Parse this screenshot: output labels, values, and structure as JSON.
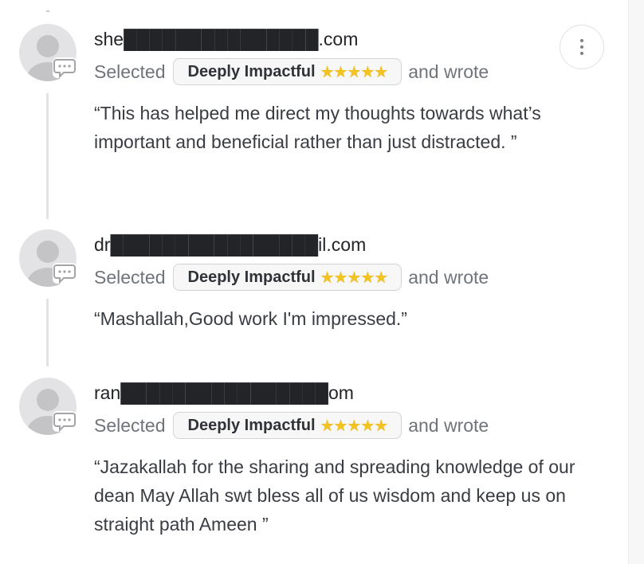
{
  "comments": [
    {
      "email": "she███████████████.com",
      "selected_text": "Selected",
      "reaction": "Deeply Impactful",
      "stars": "★★★★★",
      "wrote_text": "and wrote",
      "quote": "“This has helped me direct my thoughts towards what’s important and beneficial rather than just distracted. ”"
    },
    {
      "email": "dr████████████████il.com",
      "selected_text": "Selected",
      "reaction": "Deeply Impactful",
      "stars": "★★★★★",
      "wrote_text": "and wrote",
      "quote": "“Mashallah,Good work I'm impressed.”"
    },
    {
      "email": "ran████████████████om",
      "selected_text": "Selected",
      "reaction": "Deeply Impactful",
      "stars": "★★★★★",
      "wrote_text": "and wrote",
      "quote": "“Jazakallah for the sharing and spreading knowledge of our dean May Allah swt bless all of us wisdom and keep us on straight path Ameen ”"
    }
  ],
  "icons": {
    "avatar": "default-user-avatar-icon",
    "comment_badge": "speech-bubble-icon",
    "menu": "more-vertical-icon"
  },
  "colors": {
    "star": "#f3c321",
    "pill_background": "#f7f7f8",
    "muted_text": "#6f747b"
  }
}
